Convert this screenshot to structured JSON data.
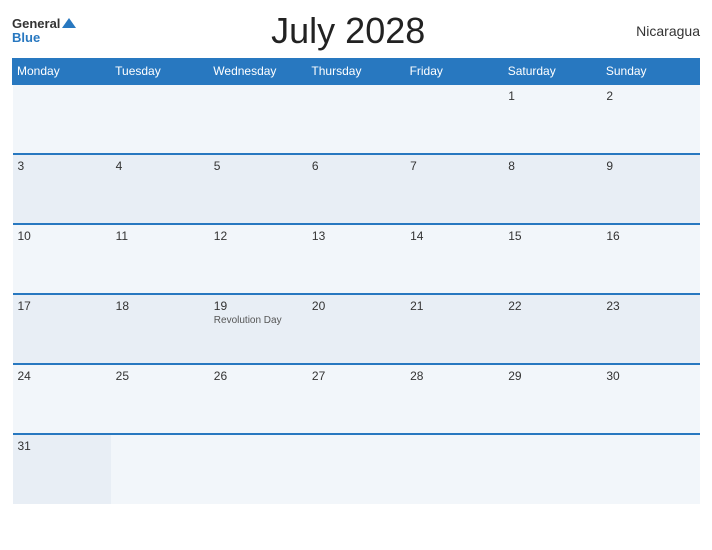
{
  "header": {
    "logo_general": "General",
    "logo_blue": "Blue",
    "month_title": "July 2028",
    "country": "Nicaragua"
  },
  "weekdays": [
    "Monday",
    "Tuesday",
    "Wednesday",
    "Thursday",
    "Friday",
    "Saturday",
    "Sunday"
  ],
  "rows": [
    [
      {
        "date": "",
        "holiday": ""
      },
      {
        "date": "",
        "holiday": ""
      },
      {
        "date": "",
        "holiday": ""
      },
      {
        "date": "",
        "holiday": ""
      },
      {
        "date": "",
        "holiday": ""
      },
      {
        "date": "1",
        "holiday": ""
      },
      {
        "date": "2",
        "holiday": ""
      }
    ],
    [
      {
        "date": "3",
        "holiday": ""
      },
      {
        "date": "4",
        "holiday": ""
      },
      {
        "date": "5",
        "holiday": ""
      },
      {
        "date": "6",
        "holiday": ""
      },
      {
        "date": "7",
        "holiday": ""
      },
      {
        "date": "8",
        "holiday": ""
      },
      {
        "date": "9",
        "holiday": ""
      }
    ],
    [
      {
        "date": "10",
        "holiday": ""
      },
      {
        "date": "11",
        "holiday": ""
      },
      {
        "date": "12",
        "holiday": ""
      },
      {
        "date": "13",
        "holiday": ""
      },
      {
        "date": "14",
        "holiday": ""
      },
      {
        "date": "15",
        "holiday": ""
      },
      {
        "date": "16",
        "holiday": ""
      }
    ],
    [
      {
        "date": "17",
        "holiday": ""
      },
      {
        "date": "18",
        "holiday": ""
      },
      {
        "date": "19",
        "holiday": "Revolution Day"
      },
      {
        "date": "20",
        "holiday": ""
      },
      {
        "date": "21",
        "holiday": ""
      },
      {
        "date": "22",
        "holiday": ""
      },
      {
        "date": "23",
        "holiday": ""
      }
    ],
    [
      {
        "date": "24",
        "holiday": ""
      },
      {
        "date": "25",
        "holiday": ""
      },
      {
        "date": "26",
        "holiday": ""
      },
      {
        "date": "27",
        "holiday": ""
      },
      {
        "date": "28",
        "holiday": ""
      },
      {
        "date": "29",
        "holiday": ""
      },
      {
        "date": "30",
        "holiday": ""
      }
    ],
    [
      {
        "date": "31",
        "holiday": ""
      },
      {
        "date": "",
        "holiday": ""
      },
      {
        "date": "",
        "holiday": ""
      },
      {
        "date": "",
        "holiday": ""
      },
      {
        "date": "",
        "holiday": ""
      },
      {
        "date": "",
        "holiday": ""
      },
      {
        "date": "",
        "holiday": ""
      }
    ]
  ]
}
